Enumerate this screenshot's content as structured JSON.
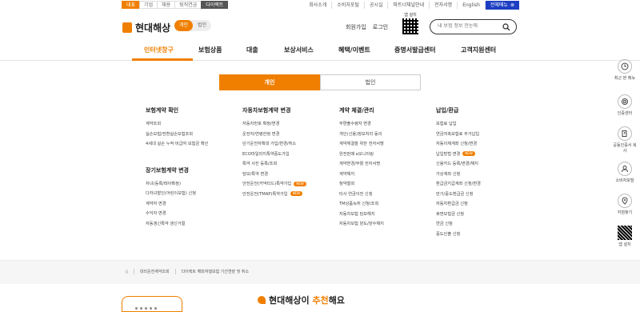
{
  "topbar": {
    "segments": [
      "대표",
      "기업",
      "채용",
      "퇴직연금",
      "다이렉트"
    ],
    "util_links": [
      "회사소개",
      "소비자포털",
      "공시실",
      "파트너채널안내",
      "전자서명",
      "English"
    ],
    "full_menu_label": "전체메뉴"
  },
  "header": {
    "logo": "현대해상",
    "toggle": [
      "개인",
      "법인"
    ],
    "login_links": [
      "회원가입",
      "로그인"
    ],
    "qr_label": "앱 설치",
    "search_placeholder": "내 보험 정보 한눈에"
  },
  "gnb": [
    "인터넷창구",
    "보험상품",
    "대출",
    "보상서비스",
    "혜택/이벤트",
    "증명서발급센터",
    "고객지원센터"
  ],
  "sidebar": [
    "최근 본 메뉴",
    "인증센터",
    "공동인증서 복사",
    "소비자포털",
    "지점찾기",
    "앱 설치"
  ],
  "tabs": [
    "개인",
    "법인"
  ],
  "columns": [
    {
      "sections": [
        {
          "title": "보험계약 확인",
          "items": [
            "계약조회",
            "실손보험/전환실손보험조회",
            "4세대 실손 누적 비급여 보험금 확인"
          ]
        },
        {
          "title": "장기보험계약 변경",
          "items": [
            "자녀(등록/태아확정)",
            "다자녀할인(어린이보험) 신청",
            "계약자 변경",
            "수익자 변경",
            "자동갱신특약 갱신거절"
          ]
        }
      ]
    },
    {
      "sections": [
        {
          "title": "자동차보험계약 변경",
          "items": [
            {
              "t": "자동차번호 확정/변경"
            },
            {
              "t": "운전자/연령한정 변경"
            },
            {
              "t": "단기운전자확대 가입/변경/취소"
            },
            {
              "t": "ECO마일리지특약중도가입"
            },
            {
              "t": "특약 사진 등록/조회"
            },
            {
              "t": "담보/특약 변경"
            },
            {
              "t": "안전운전(커넥티드)특약가입",
              "new": "NEW"
            },
            {
              "t": "안전운전(TMAP)특약가입",
              "new": "NEW"
            }
          ]
        }
      ]
    },
    {
      "sections": [
        {
          "title": "계약 체결/관리",
          "items": [
            {
              "t": "무편출수령자 변경"
            },
            {
              "t": "개인(신용)정보처리 동의"
            },
            {
              "t": "계약체결을 위한 전자서명"
            },
            {
              "t": "완전판매 e모니터링"
            },
            {
              "t": "계약변경/부활 전자서명"
            },
            {
              "t": "계약해지"
            },
            {
              "t": "청약철회"
            },
            {
              "t": "타사 연금이전 신청"
            },
            {
              "t": "TM상품녹취 신청/조회"
            },
            {
              "t": "자동차보험 담보해지"
            },
            {
              "t": "자동차보험 양도/양수해지"
            }
          ]
        }
      ]
    },
    {
      "sections": [
        {
          "title": "납입/환급",
          "items": [
            {
              "t": "보험료 납입"
            },
            {
              "t": "연금저축보험료 추가납입"
            },
            {
              "t": "자동이체계좌 신청/변경"
            },
            {
              "t": "납입방법 변경",
              "new": "NEW"
            },
            {
              "t": "신용카드 등록/변경/해지"
            },
            {
              "t": "가상계좌 신청"
            },
            {
              "t": "환급금지급계좌 신청/변경"
            },
            {
              "t": "만기/중도환급금 신청"
            },
            {
              "t": "자동차환급금 신청"
            },
            {
              "t": "휴면보험금 신청"
            },
            {
              "t": "연금 신청"
            },
            {
              "t": "중도인출 신청"
            }
          ]
        }
      ]
    }
  ],
  "breadcrumb": [
    "대리운전계약조회",
    "다이렉트 해외여행보험 기간연장 및 취소"
  ],
  "recommend": {
    "prefix": "현대해상이 ",
    "highlight": "추천",
    "suffix": "해요"
  },
  "colors": {
    "accent": "#f07f00",
    "blue": "#1b3ec2"
  }
}
